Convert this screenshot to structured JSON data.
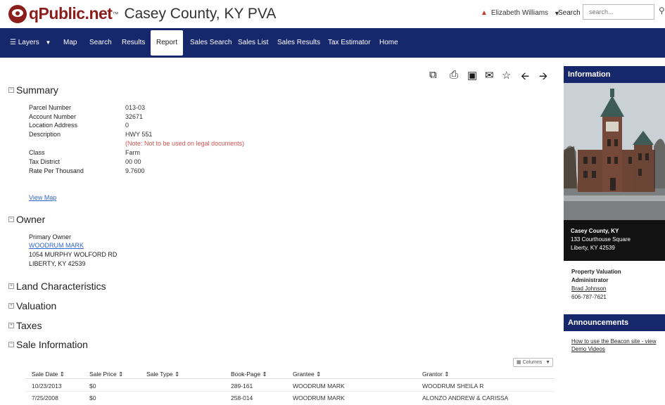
{
  "header": {
    "brand": "qPublic.net",
    "tm": "™",
    "county_title": "Casey County, KY PVA",
    "user_name": "Elizabeth Williams",
    "search_label": "Search",
    "search_placeholder": "search..."
  },
  "nav": {
    "layers": "Layers",
    "map": "Map",
    "search": "Search",
    "results": "Results",
    "report": "Report",
    "sales_search": "Sales Search",
    "sales_list": "Sales List",
    "sales_results": "Sales Results",
    "tax_estimator": "Tax Estimator",
    "home": "Home"
  },
  "summary": {
    "title": "Summary",
    "fields": [
      {
        "label": "Parcel Number",
        "value": "013-03"
      },
      {
        "label": "Account Number",
        "value": "32671"
      },
      {
        "label": "Location Address",
        "value": "0"
      },
      {
        "label": "Description",
        "value": "HWY 551"
      },
      {
        "label": "Class",
        "value": "Farm"
      },
      {
        "label": "Tax District",
        "value": "00 00"
      },
      {
        "label": "Rate Per Thousand",
        "value": "9.7600"
      }
    ],
    "note": "(Note: Not to be used on legal documents)",
    "view_map": "View Map"
  },
  "owner": {
    "title": "Owner",
    "primary_label": "Primary Owner",
    "name": "WOODRUM MARK",
    "address1": "1054 MURPHY WOLFORD RD",
    "address2": "LIBERTY, KY 42539"
  },
  "sections": {
    "land": "Land Characteristics",
    "valuation": "Valuation",
    "taxes": "Taxes",
    "sale": "Sale Information"
  },
  "sale_table": {
    "columns_button": "Columns",
    "headers": [
      "Sale Date",
      "Sale Price",
      "Sale Type",
      "Book-Page",
      "Grantee",
      "Grantor"
    ],
    "rows": [
      [
        "10/23/2013",
        "$0",
        "",
        "289-161",
        "WOODRUM MARK",
        "WOODRUM SHEILA R"
      ],
      [
        "7/25/2008",
        "$0",
        "",
        "258-014",
        "WOODRUM MARK",
        "ALONZO ANDREW & CARISSA"
      ]
    ]
  },
  "sidebar": {
    "info_title": "Information",
    "caption_line1": "Casey County, KY",
    "caption_line2": "133 Courthouse Square",
    "caption_line3": "Liberty, KY 42539",
    "pva_line1": "Property Valuation",
    "pva_line2": "Administrator",
    "pva_name": "Brad Johnson",
    "pva_phone": "606-787-7621",
    "announcements_title": "Announcements",
    "announcement_link1": "How to use the Beacon site - view",
    "announcement_link2": "Demo Videos"
  },
  "colors": {
    "nav_bg": "#17276b",
    "brand_red": "#8c1d1d",
    "note_red": "#d9534f",
    "link_blue": "#3366cc"
  }
}
